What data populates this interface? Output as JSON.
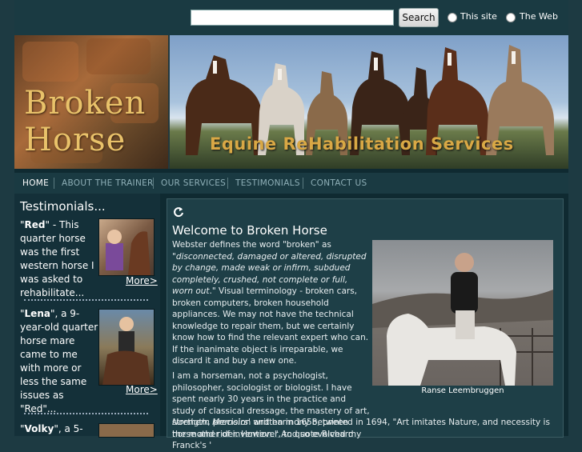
{
  "search": {
    "placeholder": "",
    "button_label": "Search",
    "scope_site": "This site",
    "scope_web": "The Web"
  },
  "banner": {
    "logo_line1": "Broken",
    "logo_line2": "Horse",
    "tagline": "Equine ReHabilitation Services"
  },
  "nav": [
    {
      "label": "HOME"
    },
    {
      "label": "ABOUT THE TRAINER"
    },
    {
      "label": "OUR SERVICES"
    },
    {
      "label": "TESTIMONIALS"
    },
    {
      "label": "CONTACT US"
    }
  ],
  "sidebar": {
    "title": "Testimonials...",
    "items": [
      {
        "name": "Red",
        "text": " - This quarter horse was the first western horse I was asked to rehabilitate...",
        "more": "More>"
      },
      {
        "name": "Lena",
        "text": ", a 9-year-old quarter horse mare came to me with more or less the same issues as \"Red\"...",
        "more": "More>"
      },
      {
        "name": "Volky",
        "text": ", a 5-"
      }
    ]
  },
  "main": {
    "refresh_icon": "refresh-icon",
    "heading": "Welcome to Broken Horse",
    "para1_a": "Webster defines the word \"broken\" as \"",
    "para1_em": "disconnected, damaged or altered, disrupted by change, made weak or infirm, subdued completely, crushed, not complete or full, worn out",
    "para1_b": ".\" Visual terminology - broken cars, broken computers, broken household appliances. We may not have the technical knowledge to repair them, but we certainly know how to find the relevant expert who can. If the inanimate object is irreparable, we discard it and buy a new one.",
    "para2_a": "I am a horseman, not a psychologist, philosopher, sociologist or biologist. I have spent nearly 30 years in the practice and study of classical dressage, the mastery of art, strength, precision and harmony between horse and rider. However, to quote Richard Franck's '",
    "para2_em": "Northern Memoirs",
    "para2_b": "' written in 1658, printed in 1694, \"Art imitates Nature, and necessity is the mother of invention.\" And so evolved my",
    "photo_caption": "Ranse Leembruggen"
  }
}
